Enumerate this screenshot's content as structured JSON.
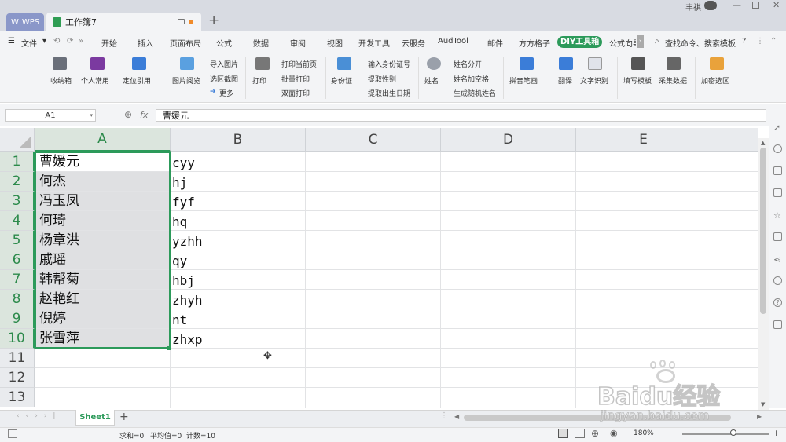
{
  "titlebar": {
    "wps_label": "WPS",
    "doc_tab": "工作簿7",
    "new_tab": "+",
    "user_name": "丰祺"
  },
  "menu": {
    "file": "文件",
    "items": [
      "开始",
      "插入",
      "页面布局",
      "公式",
      "数据",
      "审阅",
      "视图",
      "开发工具",
      "云服务",
      "AudTool",
      "邮件",
      "方方格子"
    ],
    "diy": "DIY工具箱",
    "formula_guide": "公式向导",
    "search_placeholder": "查找命令、搜索模板",
    "help": "?"
  },
  "ribbon": {
    "collection_box": "收纳箱",
    "personal": "个人常用",
    "locate": "定位引用",
    "picture_view": "图片阅览",
    "import_pic": "导入图片",
    "region_shot": "选区截图",
    "more": "更多",
    "print": "打印",
    "print_current": "打印当前页",
    "batch_print": "批量打印",
    "duplex_print": "双面打印",
    "id_card": "身份证",
    "input_id": "输入身份证号",
    "extract_gender": "提取性别",
    "extract_birth": "提取出生日期",
    "name": "姓名",
    "split_name": "姓名分开",
    "name_space": "姓名加空格",
    "random_name": "生成随机姓名",
    "pinyin": "拼音笔画",
    "translate": "翻译",
    "ocr": "文字识别",
    "fill_template": "填写模板",
    "collect_data": "采集数据",
    "encrypt_area": "加密选区"
  },
  "formula_bar": {
    "cell_ref": "A1",
    "fx": "fx",
    "content": "曹媛元"
  },
  "columns": [
    "A",
    "B",
    "C",
    "D",
    "E"
  ],
  "rows": [
    "1",
    "2",
    "3",
    "4",
    "5",
    "6",
    "7",
    "8",
    "9",
    "10",
    "11",
    "12",
    "13"
  ],
  "cells": {
    "A": [
      "曹媛元",
      "何杰",
      "冯玉凤",
      "何琦",
      "杨章洪",
      "戚瑶",
      "韩帮菊",
      "赵艳红",
      "倪婷",
      "张雪萍"
    ],
    "B": [
      "cyy",
      "hj",
      "fyf",
      "hq",
      "yzhh",
      "qy",
      "hbj",
      "zhyh",
      "nt",
      "zhxp"
    ]
  },
  "sheets": {
    "active": "Sheet1",
    "add": "+"
  },
  "status": {
    "sum": "求和=0",
    "avg": "平均值=0",
    "count": "计数=10",
    "zoom": "180%"
  },
  "watermark": {
    "brand": "Baidu经验",
    "url": "jingyan.baidu.com"
  },
  "colors": {
    "accent": "#2c9a5a",
    "selection_fill": "#dfe0e2"
  }
}
